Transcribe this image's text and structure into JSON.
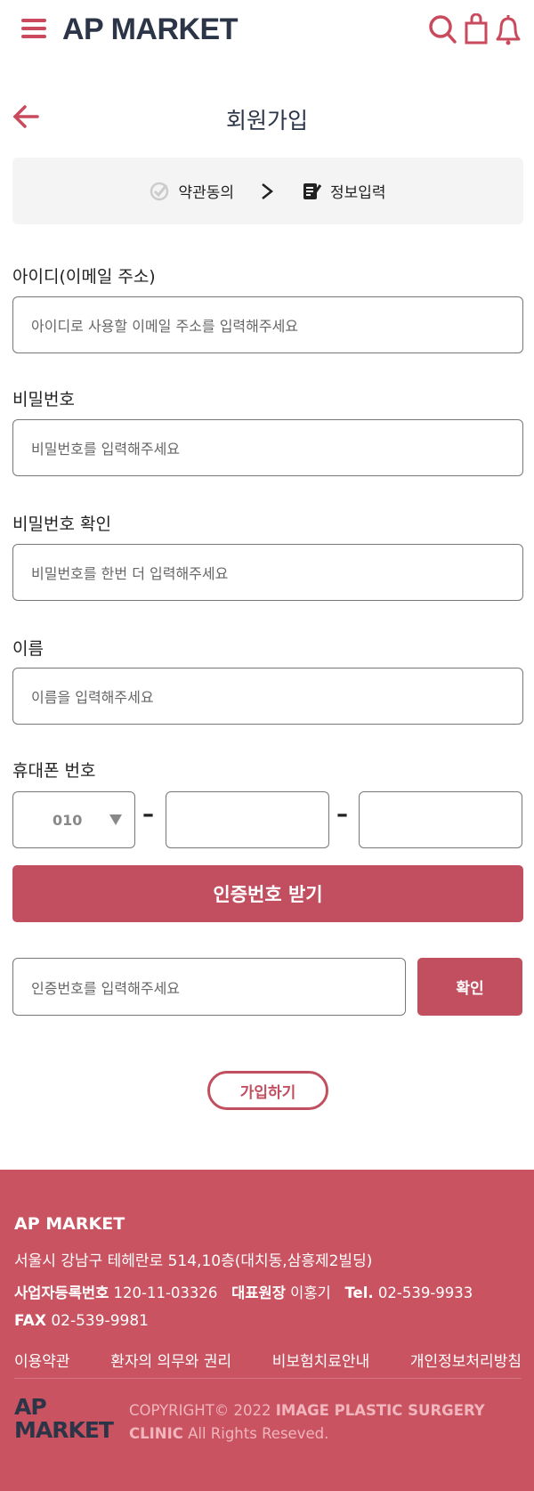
{
  "header": {
    "brand": "AP MARKET",
    "icons": [
      "menu-icon",
      "search-icon",
      "shopping-bag-icon",
      "bell-icon"
    ]
  },
  "page": {
    "title": "회원가입",
    "back_icon": "arrow-left-icon"
  },
  "steps": {
    "step1": "약관동의",
    "step2": "정보입력"
  },
  "form": {
    "email": {
      "label": "아이디(이메일 주소)",
      "placeholder": "아이디로 사용할 이메일 주소를 입력해주세요"
    },
    "password": {
      "label": "비밀번호",
      "placeholder": "비밀번호를 입력해주세요"
    },
    "password_confirm": {
      "label": "비밀번호 확인",
      "placeholder": "비밀번호를 한번 더 입력해주세요"
    },
    "name": {
      "label": "이름",
      "placeholder": "이름을 입력해주세요"
    },
    "phone": {
      "label": "휴대폰 번호",
      "prefix": "010",
      "dash": "–"
    },
    "send_code": "인증번호 받기",
    "code": {
      "placeholder": "인증번호를 입력해주세요",
      "confirm": "확인"
    },
    "submit": "가입하기"
  },
  "footer": {
    "brand": "AP MARKET",
    "address": "서울시 강남구 테헤란로 514,10층(대치동,삼흥제2빌딩)",
    "biz_label": "사업자등록번호",
    "biz_no": "120-11-03326",
    "ceo_label": "대표원장",
    "ceo": "이홍기",
    "tel_label": "Tel.",
    "tel": "02-539-9933",
    "fax_label": "FAX",
    "fax": "02-539-9981",
    "links": [
      "이용약관",
      "환자의 의무와 권리",
      "비보험치료안내",
      "개인정보처리방침"
    ],
    "logo_line1": "AP",
    "logo_line2": "MARKET",
    "copyright_a": "COPYRIGHT© 2022 ",
    "copyright_b": "IMAGE PLASTIC SURGERY CLINIC",
    "copyright_c": " All Rights Reseved."
  },
  "colors": {
    "accent": "#c14f5f",
    "footer_bg": "#c95361",
    "brand_text": "#2b3547"
  }
}
